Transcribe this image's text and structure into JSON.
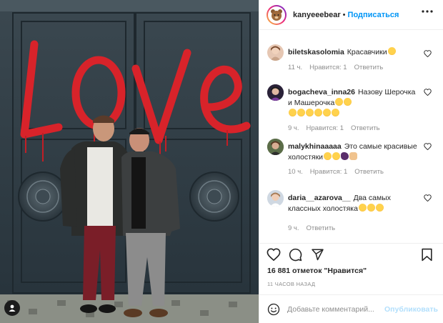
{
  "post": {
    "photo_graffiti_text": "Love",
    "username": "kanyeeebear",
    "separator": "•",
    "follow_label": "Подписаться"
  },
  "comments": [
    {
      "user": "biletskasolomia",
      "text": "Красавчики",
      "emojis": [
        "hearts"
      ],
      "time": "11 ч.",
      "likes": "Нравится: 1",
      "reply": "Ответить"
    },
    {
      "user": "bogacheva_inna26",
      "text": "Назову Шерочка и Машерочка",
      "emojis": [
        "grin",
        "grin",
        "grin",
        "grin",
        "grin",
        "grin",
        "grin",
        "grin"
      ],
      "time": "9 ч.",
      "likes": "Нравится: 1",
      "reply": "Ответить"
    },
    {
      "user": "malykhinaaaaa",
      "text": "Это самые красивые холостяки",
      "emojis": [
        "hearts",
        "hearts",
        "eggplant",
        "hand"
      ],
      "time": "10 ч.",
      "likes": "Нравится: 1",
      "reply": "Ответить"
    },
    {
      "user": "daria__azarova__",
      "text": "Два самых классных холостяка",
      "emojis": [
        "hearts",
        "hearts",
        "hearts"
      ],
      "time": "9 ч.",
      "likes": "",
      "reply": "Ответить"
    }
  ],
  "stats": {
    "likes_count": "16 881 отметок \"Нравится\"",
    "time_ago": "11 ЧАСОВ НАЗАД"
  },
  "composer": {
    "placeholder": "Добавьте комментарий...",
    "publish_label": "Опубликовать"
  },
  "colors": {
    "accent": "#0095f6",
    "publish_disabled": "#b2dffc",
    "graffiti": "#d8232a",
    "wall": "#2f3a42"
  },
  "icons": {
    "like": "heart-icon",
    "comment": "comment-icon",
    "share": "paper-plane-icon",
    "save": "bookmark-icon",
    "more": "ellipsis-icon",
    "emoji": "smiley-icon"
  }
}
